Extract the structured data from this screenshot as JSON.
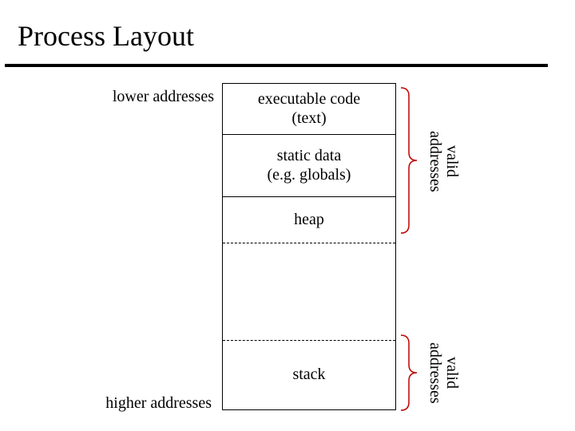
{
  "title": "Process Layout",
  "labels": {
    "lower": "lower addresses",
    "higher": "higher addresses",
    "valid": "valid\naddresses"
  },
  "segments": {
    "text_line1": "executable code",
    "text_line2": "(text)",
    "static_line1": "static data",
    "static_line2": "(e.g. globals)",
    "heap": "heap",
    "stack": "stack"
  },
  "colors": {
    "bracket": "#c00000"
  }
}
